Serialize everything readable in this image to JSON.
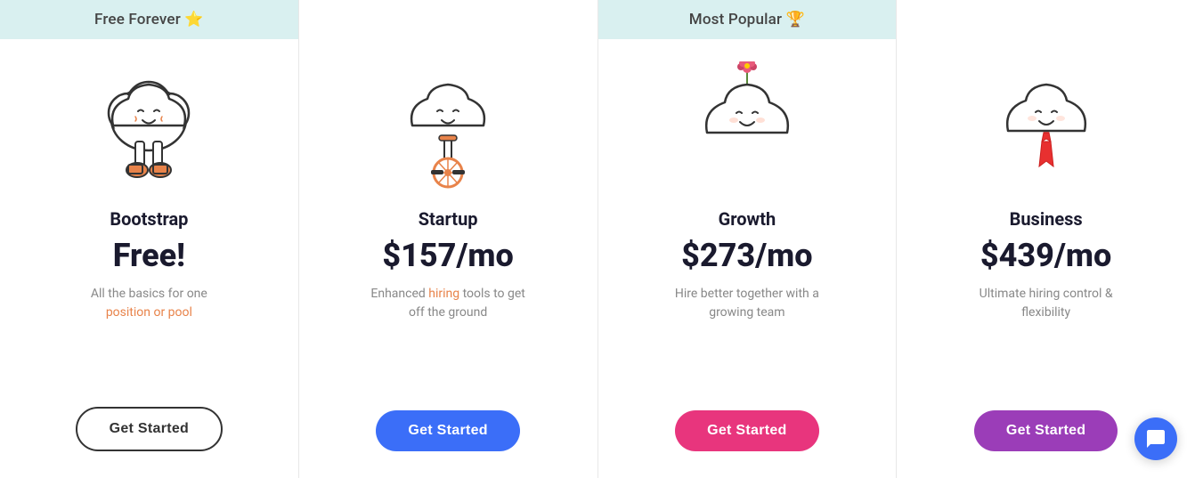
{
  "plans": [
    {
      "id": "bootstrap",
      "badge": "Free Forever ⭐",
      "badge_bg": true,
      "name": "Bootstrap",
      "price": "Free!",
      "description_parts": [
        {
          "text": "All the basics for one\nposition or pool",
          "highlight": false
        }
      ],
      "description_highlight": "position or pool",
      "description_plain": "All the basics for one",
      "btn_label": "Get Started",
      "btn_class": "btn-outline",
      "illustration": "bootstrap"
    },
    {
      "id": "startup",
      "badge": "",
      "badge_bg": false,
      "name": "Startup",
      "price": "$157/mo",
      "description": "Enhanced hiring tools to get off the ground",
      "description_highlight": "hiring",
      "btn_label": "Get Started",
      "btn_class": "btn-blue",
      "illustration": "startup"
    },
    {
      "id": "growth",
      "badge": "Most Popular 🏆",
      "badge_bg": true,
      "name": "Growth",
      "price": "$273/mo",
      "description": "Hire better together with a growing team",
      "btn_label": "Get Started",
      "btn_class": "btn-pink",
      "illustration": "growth"
    },
    {
      "id": "business",
      "badge": "",
      "badge_bg": false,
      "name": "Business",
      "price": "$439/mo",
      "description": "Ultimate hiring control & flexibility",
      "btn_label": "Get Started",
      "btn_class": "btn-purple",
      "illustration": "business"
    }
  ],
  "chat_button_label": "Chat"
}
